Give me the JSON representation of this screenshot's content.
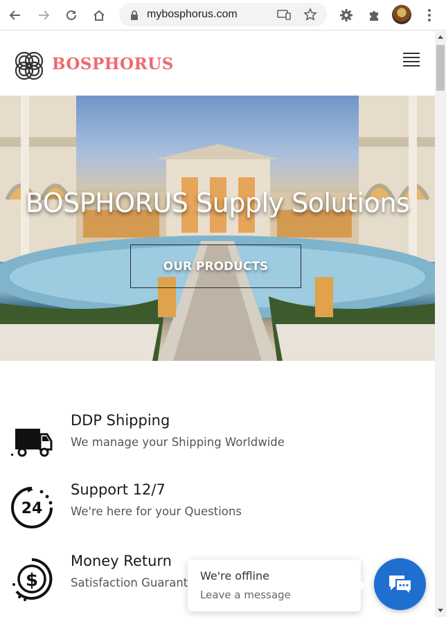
{
  "browser": {
    "url": "mybosphorus.com",
    "icons": [
      "back-arrow-icon",
      "forward-arrow-icon",
      "reload-icon",
      "home-icon",
      "lock-icon",
      "cast-icon",
      "star-icon",
      "gear-extension-icon",
      "puzzle-extensions-icon",
      "profile-avatar",
      "kebab-menu-icon"
    ]
  },
  "site": {
    "logo_text": "BOSPHORUS",
    "brand_color": "#ec6a6f",
    "menu_icon": "hamburger-icon"
  },
  "hero": {
    "title": "BOSPHORUS Supply Solutions",
    "button_label": "OUR PRODUCTS"
  },
  "features": [
    {
      "icon": "truck-icon",
      "title": "DDP Shipping",
      "description": "We manage your Shipping Worldwide"
    },
    {
      "icon": "support-24-icon",
      "title": "Support 12/7",
      "description": "We're here for your Questions"
    },
    {
      "icon": "money-return-icon",
      "title": "Money Return",
      "description": "Satisfaction Guarantee"
    }
  ],
  "chat": {
    "status": "We're offline",
    "subtitle": "Leave a message",
    "accent": "#1f6fd1",
    "icon": "chat-icon"
  }
}
